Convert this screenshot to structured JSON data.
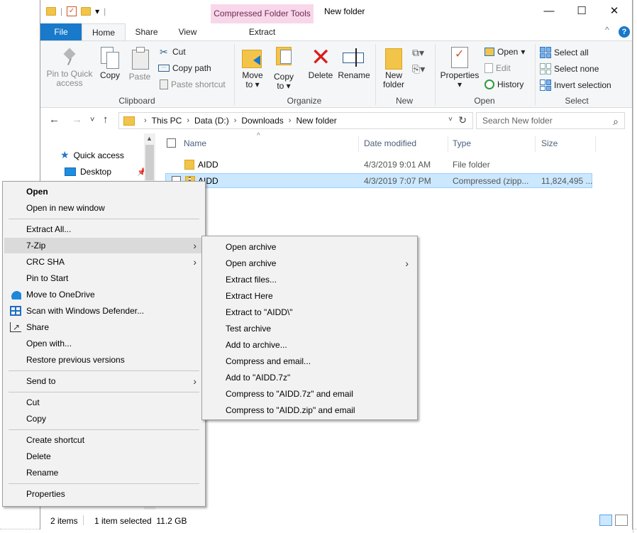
{
  "window": {
    "contextual_tab_group": "Compressed Folder Tools",
    "title": "New folder",
    "controls": {
      "minimize": "—",
      "maximize": "☐",
      "close": "✕"
    }
  },
  "qat": {
    "separator": "|",
    "dropdown": "▾"
  },
  "ribbon": {
    "tabs": [
      "File",
      "Home",
      "Share",
      "View",
      "Extract"
    ],
    "collapse": "^",
    "help": "?",
    "clipboard": {
      "label": "Clipboard",
      "pin_line1": "Pin to Quick",
      "pin_line2": "access",
      "copy": "Copy",
      "paste": "Paste",
      "cut": "Cut",
      "copy_path": "Copy path",
      "paste_shortcut": "Paste shortcut"
    },
    "organize": {
      "label": "Organize",
      "move_to_1": "Move",
      "move_to_2": "to ▾",
      "copy_to_1": "Copy",
      "copy_to_2": "to ▾",
      "delete": "Delete",
      "rename": "Rename"
    },
    "new": {
      "label": "New",
      "new_folder_1": "New",
      "new_folder_2": "folder"
    },
    "open": {
      "label": "Open",
      "properties": "Properties",
      "properties_dd": "▾",
      "open": "Open",
      "open_dd": "▾",
      "edit": "Edit",
      "history": "History"
    },
    "select": {
      "label": "Select",
      "select_all": "Select all",
      "select_none": "Select none",
      "invert": "Invert selection"
    }
  },
  "nav": {
    "back": "←",
    "forward": "→",
    "recent": "˅",
    "up": "↑",
    "breadcrumbs": [
      "This PC",
      "Data (D:)",
      "Downloads",
      "New folder"
    ],
    "crumb_sep": "›",
    "dropdown": "˅",
    "refresh": "↻",
    "search_placeholder": "Search New folder",
    "search_glyph": "⌕"
  },
  "navpane": {
    "quick_access": "Quick access",
    "desktop": "Desktop",
    "scroll_up": "▲",
    "scroll_down": "▼"
  },
  "columns": [
    "Name",
    "Date modified",
    "Type",
    "Size"
  ],
  "sort_glyph": "^",
  "files": [
    {
      "name": "AIDD",
      "date": "4/3/2019 9:01 AM",
      "type": "File folder",
      "size": ""
    },
    {
      "name": "AIDD",
      "date": "4/3/2019 7:07 PM",
      "type": "Compressed (zipp...",
      "size": "11,824,495 ..."
    }
  ],
  "status": {
    "items": "2 items",
    "selected": "1 item selected  11.2 GB"
  },
  "context_menu": {
    "open": "Open",
    "open_new_window": "Open in new window",
    "extract_all": "Extract All...",
    "seven_zip": "7-Zip",
    "crc_sha": "CRC SHA",
    "pin_to_start": "Pin to Start",
    "move_to_onedrive": "Move to OneDrive",
    "scan_defender": "Scan with Windows Defender...",
    "share": "Share",
    "open_with": "Open with...",
    "restore_versions": "Restore previous versions",
    "send_to": "Send to",
    "cut": "Cut",
    "copy": "Copy",
    "create_shortcut": "Create shortcut",
    "delete": "Delete",
    "rename": "Rename",
    "properties": "Properties",
    "arrow": "›"
  },
  "submenu_7zip": [
    "Open archive",
    "Open archive",
    "Extract files...",
    "Extract Here",
    "Extract to \"AIDD\\\"",
    "Test archive",
    "Add to archive...",
    "Compress and email...",
    "Add to \"AIDD.7z\"",
    "Compress to \"AIDD.7z\" and email",
    "Compress to \"AIDD.zip\" and email"
  ],
  "colors": {
    "accent": "#1979ca",
    "selection": "#cce8ff",
    "contextual": "#f8d7ea"
  }
}
